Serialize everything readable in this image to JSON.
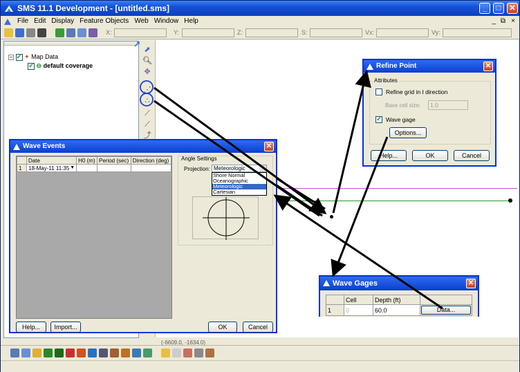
{
  "window": {
    "title": "SMS 11.1 Development - [untitled.sms]"
  },
  "menu": [
    "File",
    "Edit",
    "Display",
    "Feature Objects",
    "Web",
    "Window",
    "Help"
  ],
  "coords": [
    "X:",
    "Y:",
    "Z:",
    "S:",
    "Vx:",
    "Vy:"
  ],
  "tree": {
    "root": "Map Data",
    "child": "default coverage"
  },
  "status": {
    "coord_text": "(-6609.0, -1634.0)"
  },
  "wave_events": {
    "title": "Wave Events",
    "columns": [
      "",
      "Date",
      "H0 (m)",
      "Period (sec)",
      "Direction (deg)"
    ],
    "rows": [
      {
        "idx": "1",
        "date": "18-May-11 11:35",
        "h0": "",
        "period": "",
        "direction": ""
      }
    ],
    "angle_group": "Angle Settings",
    "projection_label": "Projection:",
    "projection_value": "Meteorologic",
    "projection_options": [
      "Shore Normal",
      "Oceanographic",
      "Meteorologic",
      "Cartesian"
    ],
    "projection_selected_index": 2,
    "buttons": {
      "help": "Help...",
      "import": "Import...",
      "ok": "OK",
      "cancel": "Cancel"
    }
  },
  "refine_point": {
    "title": "Refine Point",
    "group": "Attributes",
    "refine_label": "Refine grid in I direction",
    "refine_checked": false,
    "base_cell_label": "Base cell size:",
    "base_cell_value": "1.0",
    "wave_gage_label": "Wave gage",
    "wave_gage_checked": true,
    "buttons": {
      "options": "Options...",
      "help": "Help...",
      "ok": "OK",
      "cancel": "Cancel"
    }
  },
  "wave_gages": {
    "title": "Wave Gages",
    "columns": [
      "",
      "Cell",
      "Depth (ft)",
      ""
    ],
    "rows": [
      {
        "idx": "1",
        "cell": "0",
        "depth": "60.0",
        "button": "Data..."
      }
    ]
  },
  "colors": {
    "title_blue": "#0a3fcf",
    "dialog_bg": "#ece9d8",
    "selection": "#316ac5",
    "highlight_circle": "#1a3fd0",
    "magenta_line": "#c050d0",
    "green_line": "#2a9a2a"
  }
}
